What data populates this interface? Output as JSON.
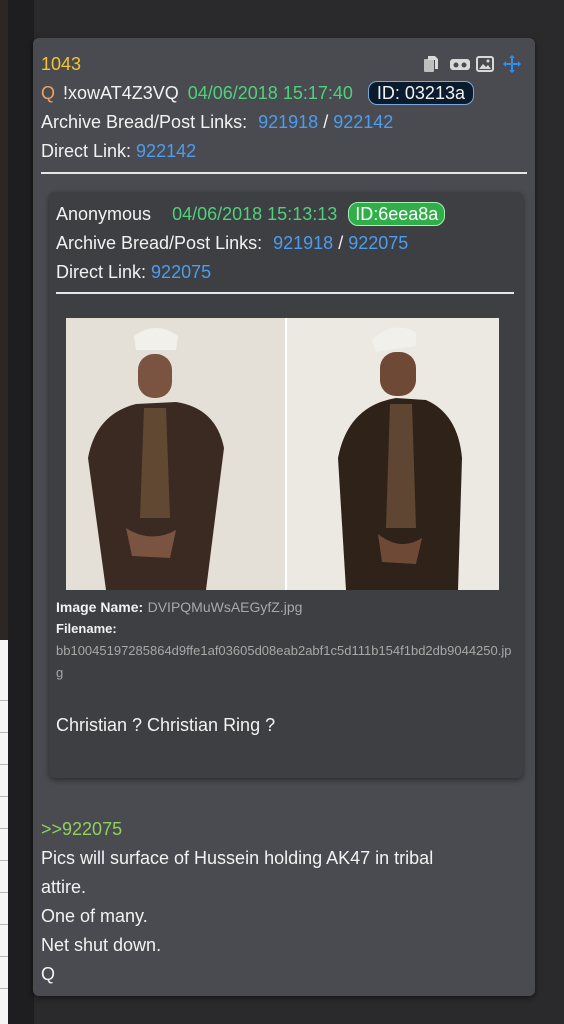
{
  "post": {
    "number": "1043",
    "author": "Q",
    "tripcode": "!xowAT4Z3VQ",
    "datetime": "04/06/2018 15:17:40",
    "id": "ID: 03213a",
    "archive_label": "Archive Bread/Post Links:",
    "archive_link_1": "921918",
    "archive_sep": "/",
    "archive_link_2": "922142",
    "direct_label": "Direct Link:",
    "direct_link": "922142",
    "icons": [
      "copy-icon",
      "vr-goggles-icon",
      "image-icon",
      "move-icon"
    ]
  },
  "quoted": {
    "author": "Anonymous",
    "datetime": "04/06/2018 15:13:13",
    "id": "ID:6eea8a",
    "archive_label": "Archive Bread/Post Links:",
    "archive_link_1": "921918",
    "archive_sep": "/",
    "archive_link_2": "922075",
    "direct_label": "Direct Link:",
    "direct_link": "922075",
    "image_name_label": "Image Name:",
    "image_name": "DVIPQMuWsAEGyfZ.jpg",
    "filename_label": "Filename:",
    "filename": "bb10045197285864d9ffe1af03605d08eab2abf1c5d111b154f1bd2db9044250.jpg",
    "body": "Christian ? Christian Ring ?"
  },
  "body": {
    "reply_link": ">>922075",
    "lines": [
      "Pics will surface of Hussein holding AK47 in tribal",
      "attire.",
      "One of many.",
      "Net shut down.",
      "Q"
    ]
  },
  "colors": {
    "post_bg": "#4a4b50",
    "quote_bg": "#3e3f43",
    "number": "#f4c430",
    "date": "#4ed17a",
    "link": "#4c9cf1",
    "reply": "#8fd15a"
  }
}
